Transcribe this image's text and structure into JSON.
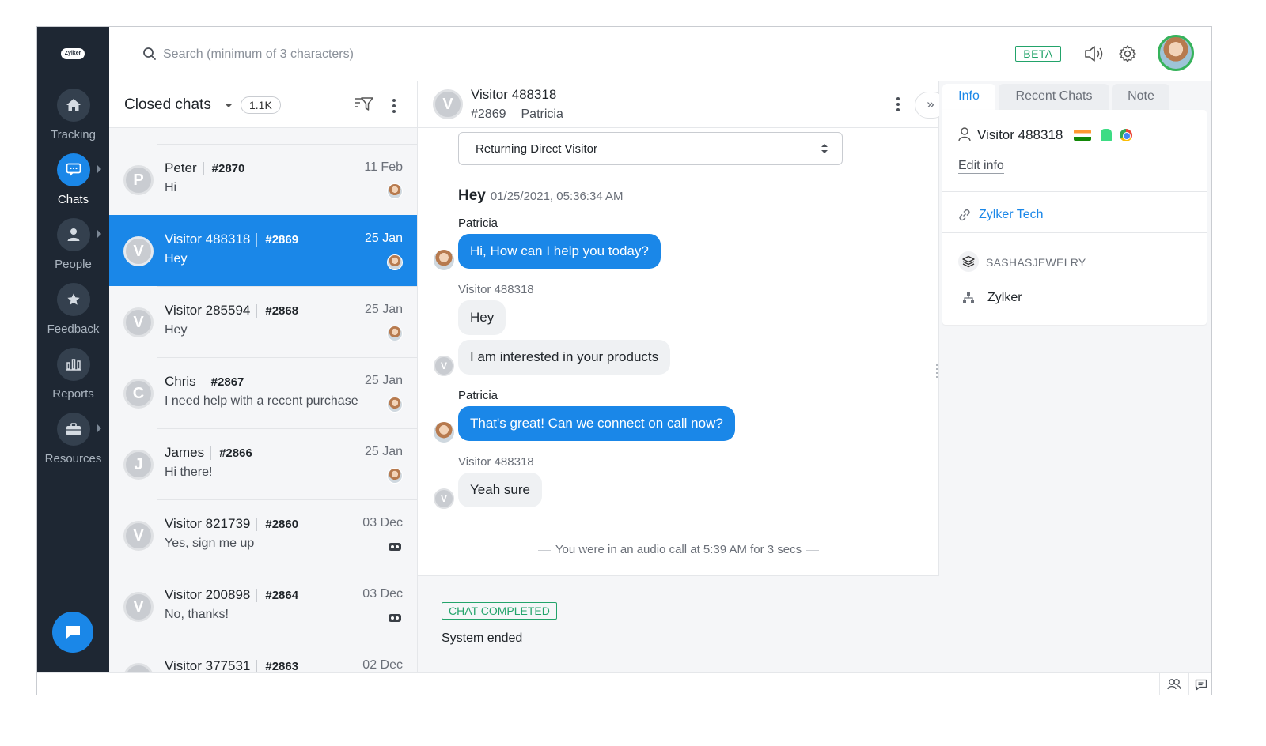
{
  "brand": {
    "logo_text": "Zylker"
  },
  "nav": [
    {
      "label": "Tracking",
      "icon": "home-icon"
    },
    {
      "label": "Chats",
      "icon": "chat-icon",
      "active": true
    },
    {
      "label": "People",
      "icon": "person-icon"
    },
    {
      "label": "Feedback",
      "icon": "star-icon"
    },
    {
      "label": "Reports",
      "icon": "bar-chart-icon"
    },
    {
      "label": "Resources",
      "icon": "briefcase-icon"
    }
  ],
  "topbar": {
    "search_placeholder": "Search (minimum of 3 characters)",
    "beta_label": "BETA"
  },
  "list": {
    "title": "Closed chats",
    "count": "1.1K",
    "chats": [
      {
        "initial": "P",
        "name": "Peter",
        "id": "#2870",
        "msg": "Hi",
        "date": "11 Feb",
        "agent": "operator"
      },
      {
        "initial": "V",
        "name": "Visitor 488318",
        "id": "#2869",
        "msg": "Hey",
        "date": "25 Jan",
        "agent": "operator",
        "selected": true
      },
      {
        "initial": "V",
        "name": "Visitor 285594",
        "id": "#2868",
        "msg": "Hey",
        "date": "25 Jan",
        "agent": "operator"
      },
      {
        "initial": "C",
        "name": "Chris",
        "id": "#2867",
        "msg": "I need help with a recent purchase",
        "date": "25 Jan",
        "agent": "operator"
      },
      {
        "initial": "J",
        "name": "James",
        "id": "#2866",
        "msg": "Hi there!",
        "date": "25 Jan",
        "agent": "operator"
      },
      {
        "initial": "V",
        "name": "Visitor 821739",
        "id": "#2860",
        "msg": "Yes, sign me up",
        "date": "03 Dec",
        "agent": "bot"
      },
      {
        "initial": "V",
        "name": "Visitor 200898",
        "id": "#2864",
        "msg": "No, thanks!",
        "date": "03 Dec",
        "agent": "bot"
      },
      {
        "initial": "V",
        "name": "Visitor 377531",
        "id": "#2863",
        "msg": "",
        "date": "02 Dec",
        "agent": "bot"
      }
    ]
  },
  "conversation": {
    "visitor_name": "Visitor 488318",
    "chat_id": "#2869",
    "agent_name": "Patricia",
    "visitor_type": "Returning Direct Visitor",
    "title": "Hey",
    "title_time": "01/25/2021, 05:36:34 AM",
    "messages": {
      "s1": "Patricia",
      "m1": "Hi, How can I help you today?",
      "s2": "Visitor 488318",
      "m2": "Hey",
      "m3": "I am interested in your products",
      "s3": "Patricia",
      "m4": "That's great! Can we connect on call now?",
      "s4": "Visitor 488318",
      "m5": "Yeah sure"
    },
    "call_note": "You were in an audio call at 5:39 AM for 3 secs",
    "status": "CHAT COMPLETED",
    "ended_text": "System ended"
  },
  "info": {
    "tabs": [
      "Info",
      "Recent Chats",
      "Note"
    ],
    "visitor_name": "Visitor 488318",
    "edit_label": "Edit info",
    "company": "Zylker Tech",
    "department": "SASHASJEWELRY",
    "brand": "Zylker"
  },
  "colors": {
    "accent": "#1a87e8",
    "rail": "#1e2733",
    "success": "#22a36a"
  }
}
